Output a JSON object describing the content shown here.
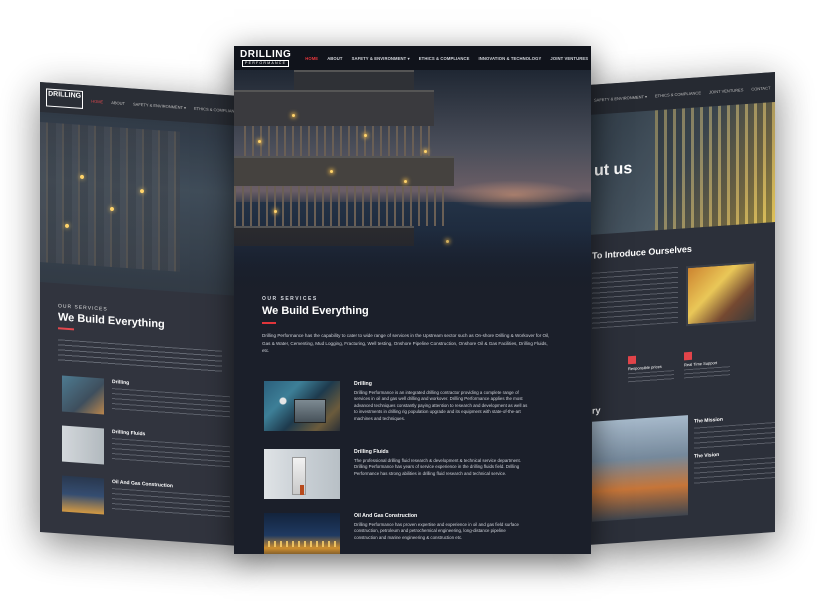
{
  "nav": {
    "logo_top": "DRILLING",
    "logo_bottom": "PERFORMANCE",
    "items": [
      {
        "label": "HOME",
        "active": true
      },
      {
        "label": "ABOUT",
        "active": false
      },
      {
        "label": "SAFETY & ENVIRONMENT ▾",
        "active": false
      },
      {
        "label": "ETHICS & COMPLIANCE",
        "active": false
      },
      {
        "label": "INNOVATION & TECHNOLOGY",
        "active": false
      },
      {
        "label": "JOINT VENTURES",
        "active": false
      },
      {
        "label": "CONTACT",
        "active": false
      }
    ]
  },
  "services": {
    "subtitle": "OUR SERVICES",
    "title": "We Build Everything",
    "intro": "Drilling Performance has the capability to cater to wide range of services in the Upstream sector such as On-shore Drilling & Workover for Oil, Gas & Water, Cementing, Mud Logging, Fracturing, Well testing, Onshore Pipeline Construction, Onshore Oil & Gas Facilities, Drilling Fluids, etc.",
    "items": [
      {
        "title": "Drilling",
        "text": "Drilling Performance is an integrated drilling contractor providing a complete range of services in oil and gas well drilling and workover. Drilling Performance applies the most advanced techniques constantly paying attention to research and development as well as to investments in drilling rig population upgrade and its equipment with state-of-the-art machines and techniques."
      },
      {
        "title": "Drilling Fluids",
        "text": "The professional drilling fluid research & development & technical service department. Drilling Performance has years of service experience in the drilling fluids field. Drilling Performance has strong abilities in drilling fluid research and technical service."
      },
      {
        "title": "Oil And Gas Construction",
        "text": "Drilling Performance has proven expertise and experience in oil and gas field surface construction, petroleum and petrochemical engineering, long-distance pipeline construction and marine engineering & construction etc."
      }
    ]
  },
  "left_mock": {
    "subtitle": "OUR SERVICES",
    "title": "We Build Everything",
    "item1": "Drilling",
    "item2": "Drilling Fluids",
    "item3": "Oil And Gas Construction"
  },
  "right_mock": {
    "hero_title": "ut us",
    "intro_title": "To Introduce Ourselves",
    "feat1": "Responsible prices",
    "feat2": "Real Time Support",
    "story_title": "ry",
    "mission": "The Mission",
    "vision": "The Vision"
  },
  "colors": {
    "accent": "#e0353b",
    "background": "#1b1f2a",
    "nav": "#10131b"
  }
}
